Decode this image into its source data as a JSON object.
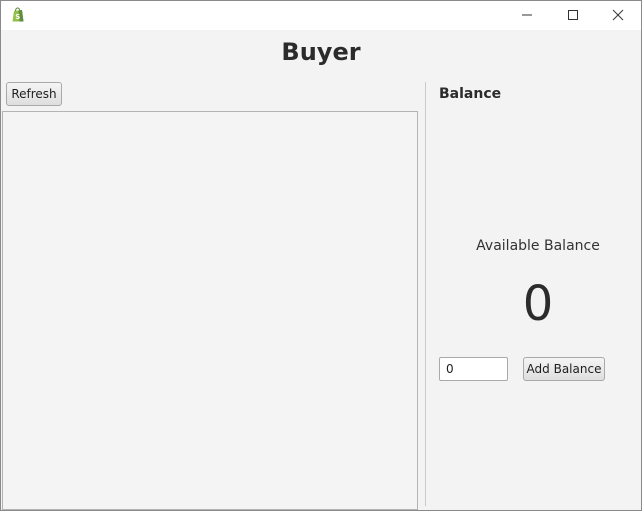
{
  "titlebar": {
    "app_icon": "shopping-bag-icon",
    "minimize_icon": "minimize-icon",
    "maximize_icon": "maximize-icon",
    "close_icon": "close-icon",
    "app_icon_color": "#5e8e3e"
  },
  "page": {
    "title": "Buyer"
  },
  "left": {
    "refresh_label": "Refresh",
    "items": []
  },
  "right": {
    "heading": "Balance",
    "available_label": "Available Balance",
    "balance_value": "0",
    "amount_input_value": "0",
    "add_button_label": "Add Balance"
  }
}
